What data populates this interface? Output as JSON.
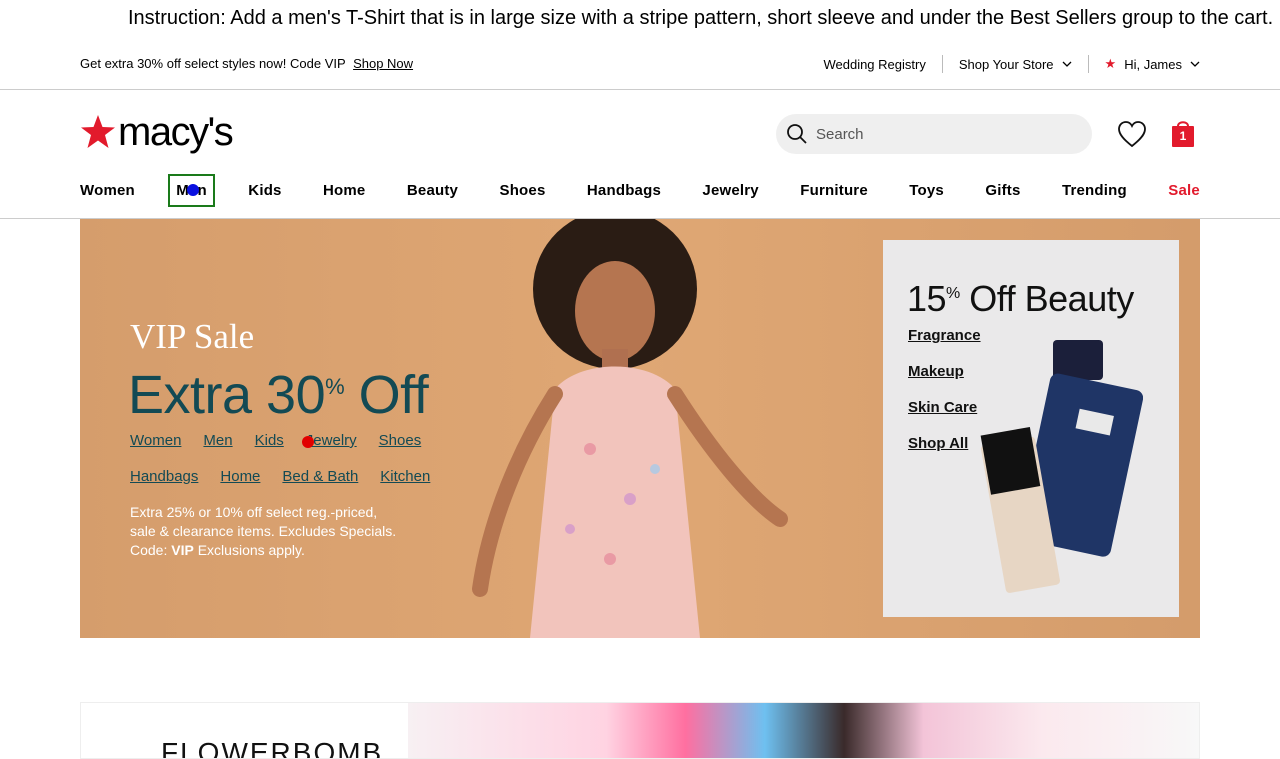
{
  "instruction": "Instruction: Add a men's T-Shirt that is in large size with a stripe pattern, short sleeve and under the Best Sellers group to the cart.",
  "utility": {
    "promo_text": "Get extra 30% off select styles now! Code VIP",
    "promo_link": "Shop Now",
    "wedding_registry": "Wedding Registry",
    "shop_store": "Shop Your Store",
    "greeting": "Hi, James"
  },
  "header": {
    "logo_text": "macy's",
    "search_placeholder": "Search",
    "bag_count": "1"
  },
  "nav": {
    "items": [
      "Women",
      "Men",
      "Kids",
      "Home",
      "Beauty",
      "Shoes",
      "Handbags",
      "Jewelry",
      "Furniture",
      "Toys",
      "Gifts",
      "Trending",
      "Sale"
    ]
  },
  "hero": {
    "vip": "VIP Sale",
    "extra": "Extra 30",
    "extra_sup": "%",
    "extra_tail": " Off",
    "links_row1": [
      "Women",
      "Men",
      "Kids",
      "Jewelry",
      "Shoes"
    ],
    "links_row2": [
      "Handbags",
      "Home",
      "Bed & Bath",
      "Kitchen"
    ],
    "fine_line1": "Extra 25% or 10% off select reg.-priced,",
    "fine_line2": "sale & clearance items. Excludes Specials.",
    "fine_code_label": "Code:",
    "fine_code": "VIP",
    "fine_tail": "Exclusions apply."
  },
  "beauty": {
    "title_num": "15",
    "title_sup": "%",
    "title_tail": " Off Beauty",
    "links": [
      "Fragrance",
      "Makeup",
      "Skin Care",
      "Shop All"
    ]
  },
  "banner2": {
    "title": "FLOWERBOMB"
  },
  "colors": {
    "brand_red": "#e21a2c",
    "hero_teal": "#134a54",
    "hero_bg": "#dfa774"
  }
}
